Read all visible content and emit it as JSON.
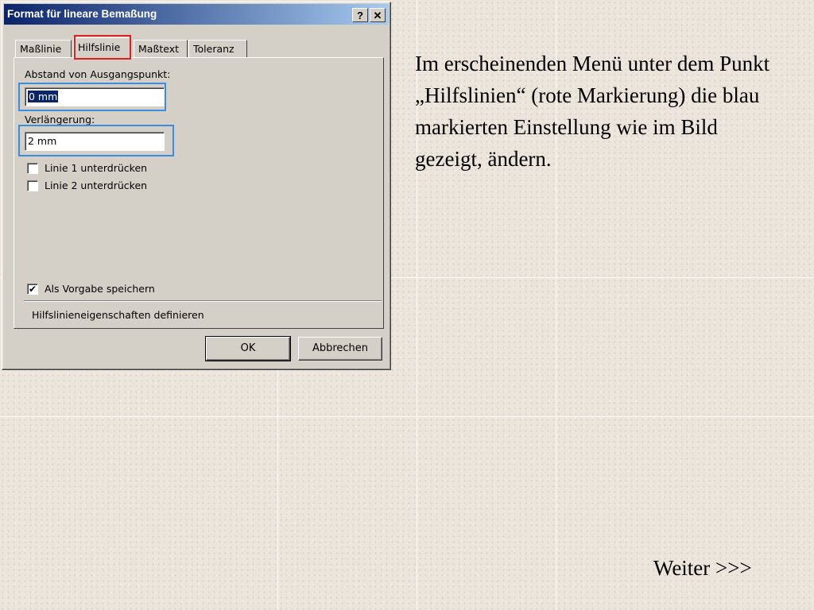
{
  "dialog": {
    "title": "Format für lineare Bemaßung",
    "help_label": "?",
    "close_label": "✕",
    "tabs": [
      {
        "label": "Maßlinie",
        "active": false
      },
      {
        "label": "Hilfslinie",
        "active": true
      },
      {
        "label": "Maßtext",
        "active": false
      },
      {
        "label": "Toleranz",
        "active": false
      }
    ],
    "abstand_label": "Abstand von Ausgangspunkt:",
    "abstand_value": "0 mm",
    "verlaengerung_label": "Verlängerung:",
    "verlaengerung_value": "2 mm",
    "checkboxes": [
      {
        "label": "Linie 1 unterdrücken",
        "checked": false
      },
      {
        "label": "Linie 2 unterdrücken",
        "checked": false
      }
    ],
    "save_default": {
      "label": "Als Vorgabe speichern",
      "checked": true,
      "mark": "✔"
    },
    "description": "Hilfslinieneigenschaften definieren",
    "ok_label": "OK",
    "cancel_label": "Abbrechen",
    "colors": {
      "tab_marker": "#e02020",
      "field_marker": "#3c8ce0",
      "title_bar": "#0a246a"
    }
  },
  "instruction": {
    "text": "Im erscheinenden Menü unter dem Punkt „Hilfslinien“ (rote Markierung) die blau markierten Einstellung wie im Bild gezeigt, ändern."
  },
  "nav": {
    "next_label": "Weiter >>>"
  }
}
